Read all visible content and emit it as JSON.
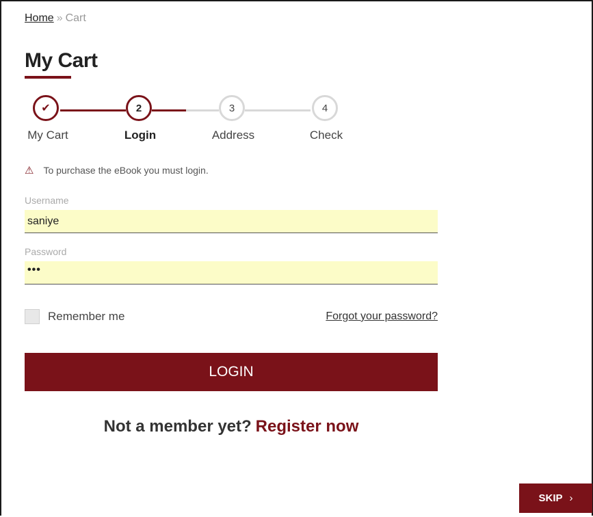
{
  "breadcrumb": {
    "home": "Home",
    "separator": "»",
    "current": "Cart"
  },
  "page": {
    "title": "My Cart"
  },
  "stepper": {
    "steps": [
      {
        "number": "✔",
        "label": "My Cart",
        "state": "done"
      },
      {
        "number": "2",
        "label": "Login",
        "state": "active"
      },
      {
        "number": "3",
        "label": "Address",
        "state": "pending"
      },
      {
        "number": "4",
        "label": "Check",
        "state": "pending"
      }
    ]
  },
  "notice": {
    "icon": "warning-icon",
    "text": "To purchase the eBook you must login."
  },
  "form": {
    "username_label": "Username",
    "username_value": "saniye",
    "password_label": "Password",
    "password_value": "•••",
    "remember_label": "Remember me",
    "forgot_link": "Forgot your password?",
    "login_button": "LOGIN"
  },
  "register": {
    "prompt": "Not a member yet?",
    "link": "Register now"
  },
  "skip": {
    "label": "SKIP",
    "icon": "chevron-right-icon",
    "chevron": "›"
  },
  "colors": {
    "accent": "#7a1219",
    "field_bg": "#fcfcc8",
    "pending": "#d8d8d8"
  }
}
